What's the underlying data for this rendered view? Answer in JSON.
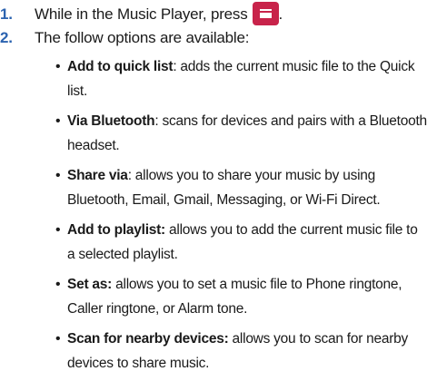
{
  "steps": [
    {
      "number": "1.",
      "text_before": "While in the Music Player, press",
      "text_after": ".",
      "icon": "menu-key-icon"
    },
    {
      "number": "2.",
      "text": "The follow options are available:"
    }
  ],
  "options": [
    {
      "term": "Add to quick list",
      "sep": ":",
      "desc": " adds the current music file to the Quick list."
    },
    {
      "term": "Via Bluetooth",
      "sep": ":",
      "desc": " scans for devices and pairs with a Bluetooth headset."
    },
    {
      "term": "Share via",
      "sep": ":",
      "desc": " allows you to share your music by using Bluetooth, Email, Gmail, Messaging, or Wi-Fi Direct."
    },
    {
      "term": "Add to playlist:",
      "sep": "",
      "desc": " allows you to add the current music file to a selected playlist."
    },
    {
      "term": "Set as:",
      "sep": "",
      "desc": " allows you to set a music file to Phone ringtone, Caller ringtone, or Alarm tone."
    },
    {
      "term": "Scan for nearby devices:",
      "sep": "",
      "desc": " allows you to scan for nearby devices to share music."
    }
  ],
  "colors": {
    "number": "#2b63b0",
    "menu_key": "#c8234a",
    "text": "#1a1a1a"
  }
}
